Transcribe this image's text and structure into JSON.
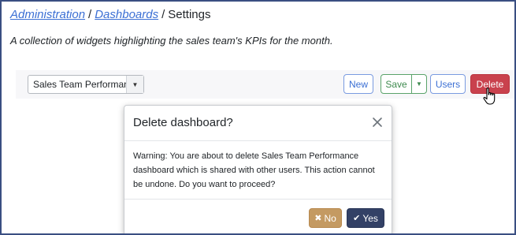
{
  "breadcrumb": {
    "items": [
      "Administration",
      "Dashboards"
    ],
    "current": "Settings",
    "separator": "/"
  },
  "description": "A collection of widgets highlighting the sales team's KPIs for the month.",
  "toolbar": {
    "dashboard_select": {
      "value": "Sales Team Performance"
    },
    "new_label": "New",
    "save_label": "Save",
    "users_label": "Users",
    "delete_label": "Delete"
  },
  "modal": {
    "title": "Delete dashboard?",
    "body": "Warning: You are about to delete Sales Team Performance dashboard which is shared with other users. This action cannot be undone. Do you want to proceed?",
    "no_label": "No",
    "yes_label": "Yes"
  },
  "icons": {
    "close": "close-icon",
    "caret": "caret-down-icon",
    "no": "times-icon",
    "yes": "check-icon",
    "cursor": "hand-pointer-icon"
  },
  "colors": {
    "link": "#3b6fd4",
    "delete": "#c9414d",
    "no": "#c49a62",
    "yes": "#334166",
    "save": "#3f8a4f",
    "frame": "#3a4f82"
  }
}
